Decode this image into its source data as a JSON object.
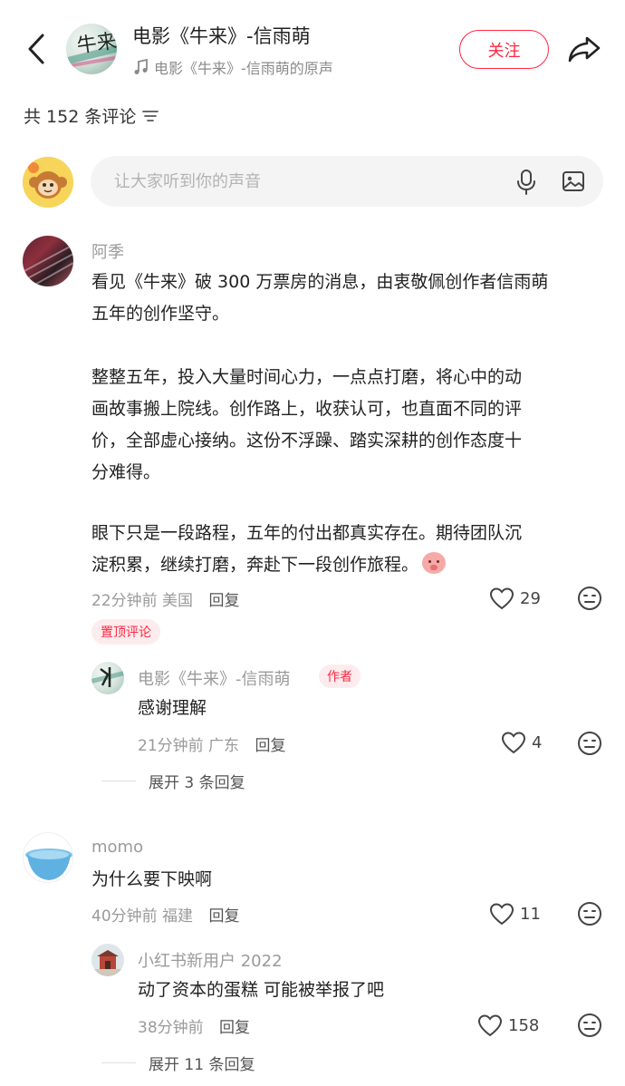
{
  "header": {
    "title": "电影《牛来》-信雨萌",
    "subtitle": "电影《牛来》-信雨萌的原声",
    "follow_label": "关注",
    "avatar_text": "牛来"
  },
  "comments_header": {
    "count_text": "共 152 条评论"
  },
  "input": {
    "placeholder": "让大家听到你的声音"
  },
  "comments": [
    {
      "user": "阿季",
      "lines": [
        "看见《牛来》破 300 万票房的消息，由衷敬佩创作者信雨萌",
        "五年的创作坚守。",
        "",
        "整整五年，投入大量时间心力，一点点打磨，将心中的动",
        "画故事搬上院线。创作路上，收获认可，也直面不同的评",
        "价，全部虚心接纳。这份不浮躁、踏实深耕的创作态度十",
        "分难得。",
        "",
        "眼下只是一段路程，五年的付出都真实存在。期待团队沉",
        "淀积累，继续打磨，奔赴下一段创作旅程。"
      ],
      "time": "22分钟前",
      "location": "美国",
      "reply_label": "回复",
      "likes": "29",
      "pinned_label": "置顶评论",
      "reply": {
        "user": "电影《牛来》-信雨萌",
        "author_badge": "作者",
        "text": "感谢理解",
        "time": "21分钟前",
        "location": "广东",
        "reply_label": "回复",
        "likes": "4"
      },
      "expand_label": "展开 3 条回复"
    },
    {
      "user": "momo",
      "text": "为什么要下映啊",
      "time": "40分钟前",
      "location": "福建",
      "reply_label": "回复",
      "likes": "11",
      "reply": {
        "user": "小红书新用户 2022",
        "text": "动了资本的蛋糕 可能被举报了吧",
        "time": "38分钟前",
        "reply_label": "回复",
        "likes": "158"
      },
      "expand_label": "展开 11 条回复"
    }
  ],
  "colors": {
    "accent": "#ff2741",
    "secondary_text": "#9a9a9a"
  }
}
